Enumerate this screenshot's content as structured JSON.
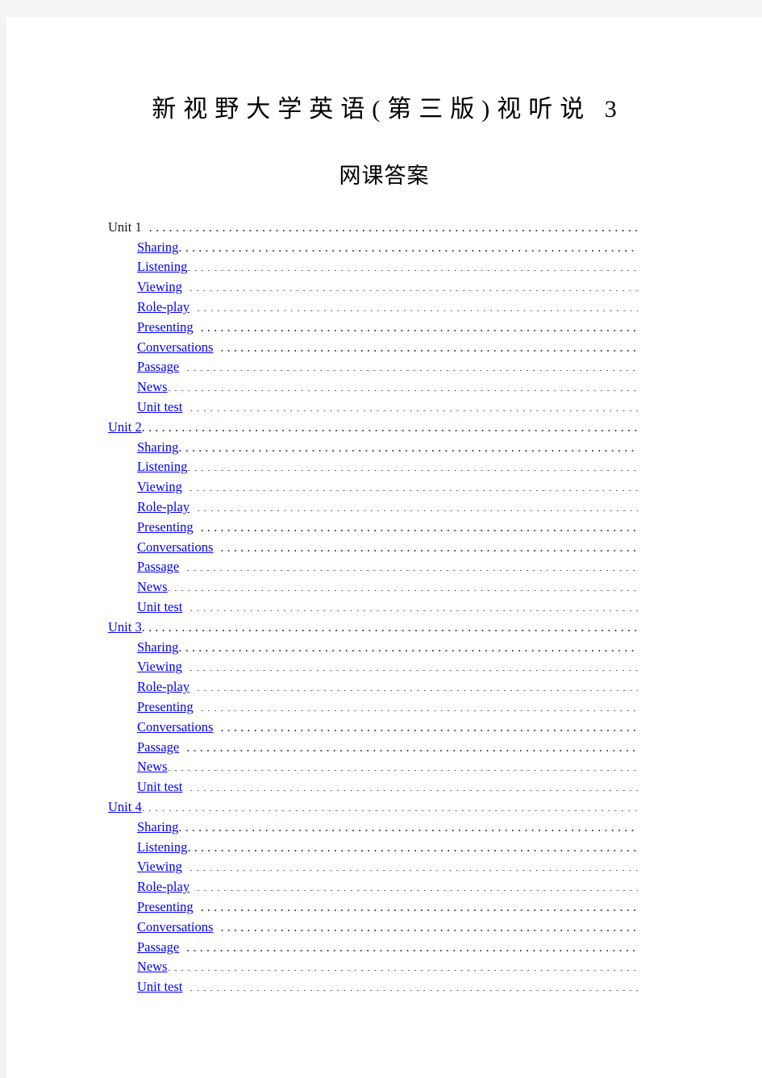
{
  "document": {
    "title": "新视野大学英语(第三版)视听说 3",
    "subtitle": "网课答案",
    "link_color": "#0000ff",
    "text_color": "#000000",
    "page_background": "#ffffff",
    "canvas_background": "#f4f4f4"
  },
  "toc": {
    "entries": [
      {
        "label": "Unit 1",
        "level": "unit",
        "is_link": false,
        "gap": true
      },
      {
        "label": "Sharing",
        "level": "item",
        "is_link": true,
        "gap": false
      },
      {
        "label": "Listening",
        "level": "item",
        "is_link": true,
        "gap": false
      },
      {
        "label": "Viewing",
        "level": "item",
        "is_link": true,
        "gap": true
      },
      {
        "label": "Role-play",
        "level": "item",
        "is_link": true,
        "gap": true
      },
      {
        "label": "Presenting",
        "level": "item",
        "is_link": true,
        "gap": true
      },
      {
        "label": "Conversations",
        "level": "item",
        "is_link": true,
        "gap": true
      },
      {
        "label": "Passage",
        "level": "item",
        "is_link": true,
        "gap": true
      },
      {
        "label": "News",
        "level": "item",
        "is_link": true,
        "gap": false
      },
      {
        "label": "Unit test",
        "level": "item",
        "is_link": true,
        "gap": true
      },
      {
        "label": "Unit 2",
        "level": "unit",
        "is_link": true,
        "gap": false
      },
      {
        "label": "Sharing",
        "level": "item",
        "is_link": true,
        "gap": false
      },
      {
        "label": "Listening",
        "level": "item",
        "is_link": true,
        "gap": false
      },
      {
        "label": "Viewing",
        "level": "item",
        "is_link": true,
        "gap": true
      },
      {
        "label": "Role-play",
        "level": "item",
        "is_link": true,
        "gap": true
      },
      {
        "label": "Presenting",
        "level": "item",
        "is_link": true,
        "gap": true
      },
      {
        "label": "Conversations",
        "level": "item",
        "is_link": true,
        "gap": true
      },
      {
        "label": "Passage",
        "level": "item",
        "is_link": true,
        "gap": true
      },
      {
        "label": "News",
        "level": "item",
        "is_link": true,
        "gap": false
      },
      {
        "label": "Unit test",
        "level": "item",
        "is_link": true,
        "gap": true
      },
      {
        "label": "Unit 3",
        "level": "unit",
        "is_link": true,
        "gap": false
      },
      {
        "label": "Sharing",
        "level": "item",
        "is_link": true,
        "gap": false
      },
      {
        "label": "Viewing",
        "level": "item",
        "is_link": true,
        "gap": true
      },
      {
        "label": "Role-play",
        "level": "item",
        "is_link": true,
        "gap": true
      },
      {
        "label": "Presenting",
        "level": "item",
        "is_link": true,
        "gap": true
      },
      {
        "label": "Conversations",
        "level": "item",
        "is_link": true,
        "gap": true
      },
      {
        "label": "Passage",
        "level": "item",
        "is_link": true,
        "gap": true
      },
      {
        "label": "News",
        "level": "item",
        "is_link": true,
        "gap": false
      },
      {
        "label": "Unit test",
        "level": "item",
        "is_link": true,
        "gap": true
      },
      {
        "label": "Unit 4",
        "level": "unit",
        "is_link": true,
        "gap": false
      },
      {
        "label": "Sharing",
        "level": "item",
        "is_link": true,
        "gap": false
      },
      {
        "label": "Listening",
        "level": "item",
        "is_link": true,
        "gap": false
      },
      {
        "label": "Viewing",
        "level": "item",
        "is_link": true,
        "gap": true
      },
      {
        "label": "Role-play",
        "level": "item",
        "is_link": true,
        "gap": true
      },
      {
        "label": "Presenting",
        "level": "item",
        "is_link": true,
        "gap": true
      },
      {
        "label": "Conversations",
        "level": "item",
        "is_link": true,
        "gap": true
      },
      {
        "label": "Passage",
        "level": "item",
        "is_link": true,
        "gap": true
      },
      {
        "label": "News",
        "level": "item",
        "is_link": true,
        "gap": false
      },
      {
        "label": "Unit test",
        "level": "item",
        "is_link": true,
        "gap": true
      }
    ]
  }
}
